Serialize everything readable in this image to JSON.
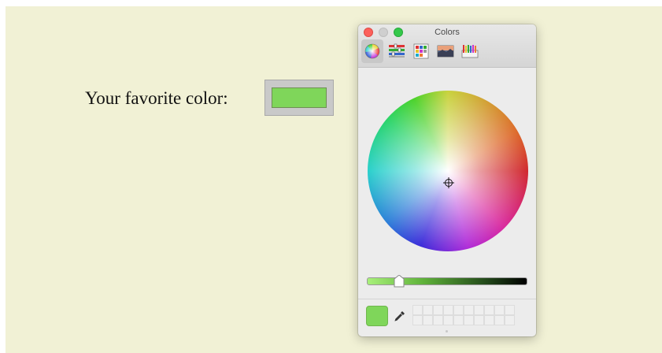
{
  "page": {
    "prompt_label": "Your favorite color:",
    "background_color": "#f1f1d5"
  },
  "color_input": {
    "value_color": "#7fd65a"
  },
  "color_panel": {
    "title": "Colors",
    "window_controls": [
      "close",
      "minimize",
      "zoom"
    ],
    "modes": [
      {
        "name": "color-wheel-icon",
        "active": true
      },
      {
        "name": "color-sliders-icon",
        "active": false
      },
      {
        "name": "color-palettes-icon",
        "active": false
      },
      {
        "name": "image-palettes-icon",
        "active": false
      },
      {
        "name": "crayons-icon",
        "active": false
      }
    ],
    "brightness_level": 0.2,
    "current_color": "#7fd65a",
    "swatch_slots": 20
  }
}
